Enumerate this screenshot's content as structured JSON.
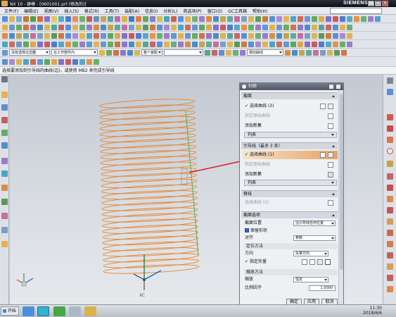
{
  "window": {
    "title": "NX 10 - 建模 - [0601001.prt (修改的)]",
    "brand": "SIEMENS",
    "min": "_",
    "max": "□",
    "close": "×"
  },
  "menu": {
    "items": [
      "文件(F)",
      "编辑(E)",
      "视图(V)",
      "插入(S)",
      "格式(R)",
      "工具(T)",
      "装配(A)",
      "信息(I)",
      "分析(L)",
      "首选项(P)",
      "窗口(O)",
      "GC工具箱",
      "帮助(H)"
    ]
  },
  "toolbar": {
    "filter_combo": "没有选择过滤器",
    "scope_combo": "在工作部件内",
    "snap_combo": "整个装配",
    "curve_combo": "相切曲线",
    "blank_combo": "",
    "render_label": "渲染"
  },
  "cue": "选择要添加到引导线的曲线(边)，或使用 MB2 来完成引导线",
  "dialog": {
    "title": "扫掠",
    "section_curves": "截面",
    "select_curve_1": "选择曲线 (3)",
    "specify_origin_1": "指定原始曲线",
    "add_new_set_1": "添加新集",
    "list_1": "列表",
    "guides_section": "引导线（最多 3 条）",
    "select_curve_2": "选择曲线 (1)",
    "specify_origin_2": "指定原始曲线",
    "add_new_set_2": "添加新集",
    "list_2": "列表",
    "spine_section": "脊线",
    "select_curve_3": "选择曲线 (0)",
    "options_section": "截面选项",
    "section_position_label": "截面位置",
    "section_position_value": "沿引导线任何位置",
    "preserve_shape": "保留形状",
    "alignment_label": "对齐",
    "alignment_value": "参数",
    "orientation_sub": "定位方法",
    "orientation_label": "方向",
    "orientation_value": "矢量方向",
    "specify_vector": "指定矢量",
    "scaling_sub": "缩放方法",
    "scaling_label": "缩放",
    "scaling_value": "恒定",
    "ratio_label": "比例因子",
    "ratio_value": "1.0000",
    "ok": "确定",
    "apply": "应用",
    "cancel": "取消"
  },
  "viewport": {
    "axis_label": "XC"
  },
  "taskbar": {
    "start": "开始",
    "time": "11:30",
    "date": "2018/6/6"
  },
  "colors": {
    "helix": "#e7842a",
    "guide": "#4caf50",
    "leader": "#e02020"
  },
  "icons": [
    "gear-icon",
    "check-icon",
    "reverse-icon",
    "add-set-icon",
    "origin-curve-icon",
    "vector-icon",
    "close-icon",
    "reset-icon",
    "start-icon"
  ]
}
